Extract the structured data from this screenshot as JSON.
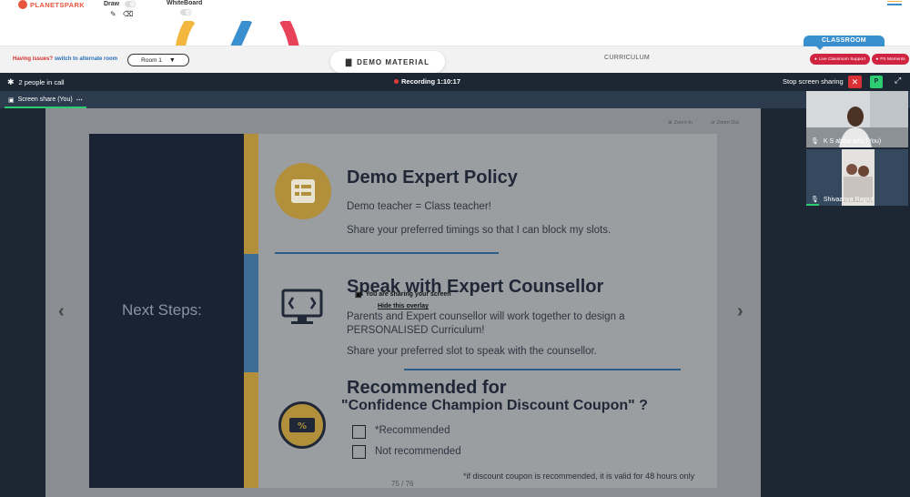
{
  "header": {
    "logo_text": "PLANETSPARK",
    "draw_label": "Draw",
    "whiteboard_label": "WhiteBoard"
  },
  "session": {
    "issues_text": "Having issues?",
    "alternate_link": "switch to alternate room",
    "room_value": "Room 1",
    "demo_material_label": "DEMO MATERIAL",
    "curriculum_label": "CURRICULUM",
    "classroom_label": "CLASSROOM",
    "live_support_label": "Live Classroom Support",
    "ps_moments_label": "PS Moments"
  },
  "meet": {
    "people_label": "2 people in call",
    "recording_label": "Recording 1:10:17",
    "stop_sharing_label": "Stop screen sharing",
    "p_badge": "P",
    "share_tab_label": "Screen share (You)",
    "zoom_in_label": "Zoom In",
    "zoom_out_label": "Zoom Out",
    "overlay_message": "You are sharing your screen",
    "overlay_link": "Hide this overlay",
    "participants": [
      {
        "name": "K S abdul aziz (You)"
      },
      {
        "name": "Shivaanya Rajput"
      }
    ]
  },
  "slide": {
    "left_title": "Next Steps:",
    "section1_title": "Demo Expert Policy",
    "section1_line1": "Demo teacher = Class teacher!",
    "section1_line2": "Share your preferred timings so that I can block my slots.",
    "section2_title": "Speak with Expert Counsellor",
    "section2_line1": "Parents and Expert counsellor will work together to design a",
    "section2_line2": "PERSONALISED Curriculum!",
    "section2_line3": "Share your preferred slot to speak with the counsellor.",
    "section3_title": "Recommended for",
    "section3_subtitle": "\"Confidence Champion Discount Coupon\" ?",
    "option1": "*Recommended",
    "option2": "Not recommended",
    "footnote": "*if discount coupon is recommended, it is valid for 48 hours only",
    "page_indicator": "75 / 76"
  },
  "colors": {
    "brand_red": "#e8553e",
    "classroom_blue": "#3a8fcf",
    "support_red": "#cf2540",
    "meet_bg": "#1c2733",
    "slide_navy": "#1a2333",
    "stripe_gold": "#b18f3b",
    "stripe_blue": "#3e6e96"
  }
}
